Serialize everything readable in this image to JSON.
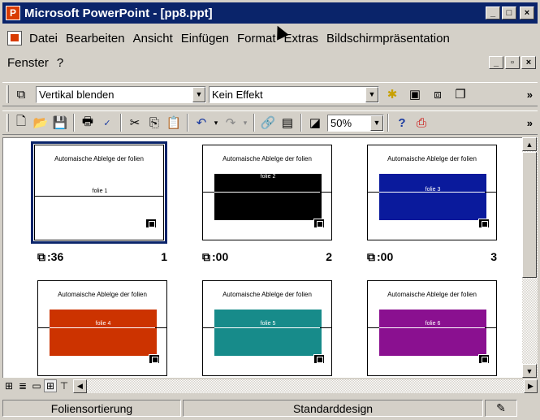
{
  "window": {
    "title": "Microsoft PowerPoint - [pp8.ppt]",
    "icon": "powerpoint-app-icon"
  },
  "menu": {
    "items": [
      {
        "label": "Datei"
      },
      {
        "label": "Bearbeiten"
      },
      {
        "label": "Ansicht"
      },
      {
        "label": "Einfügen"
      },
      {
        "label": "Format"
      },
      {
        "label": "Extras"
      },
      {
        "label": "Bildschirmpräsentation"
      }
    ],
    "row2": [
      {
        "label": "Fenster"
      },
      {
        "label": "?"
      }
    ]
  },
  "toolbar1": {
    "transition_select": "Vertikal blenden",
    "effect_select": "Kein Effekt"
  },
  "toolbar2": {
    "zoom": "50%"
  },
  "slides": [
    {
      "title": "Automaische Ablelge der folien",
      "label": "folie 1",
      "time": ":36",
      "number": "1",
      "fill": "#ffffff"
    },
    {
      "title": "Automaische Ablelge der folien",
      "label": "folie 2",
      "time": ":00",
      "number": "2",
      "fill": "#000000"
    },
    {
      "title": "Automaische Ablelge der folien",
      "label": "folie 3",
      "time": ":00",
      "number": "3",
      "fill": "#0a1a9c"
    },
    {
      "title": "Automaische Ablelge der folien",
      "label": "folie 4",
      "fill": "#cc3300"
    },
    {
      "title": "Automaische Ablelge der folien",
      "label": "folie 5",
      "fill": "#178b8a"
    },
    {
      "title": "Automaische Ablelge der folien",
      "label": "folie 6",
      "fill": "#8a1090"
    }
  ],
  "status": {
    "view": "Foliensortierung",
    "design": "Standarddesign"
  },
  "colors": {
    "titlebar": "#0a246a",
    "chrome": "#d4d0c8"
  }
}
